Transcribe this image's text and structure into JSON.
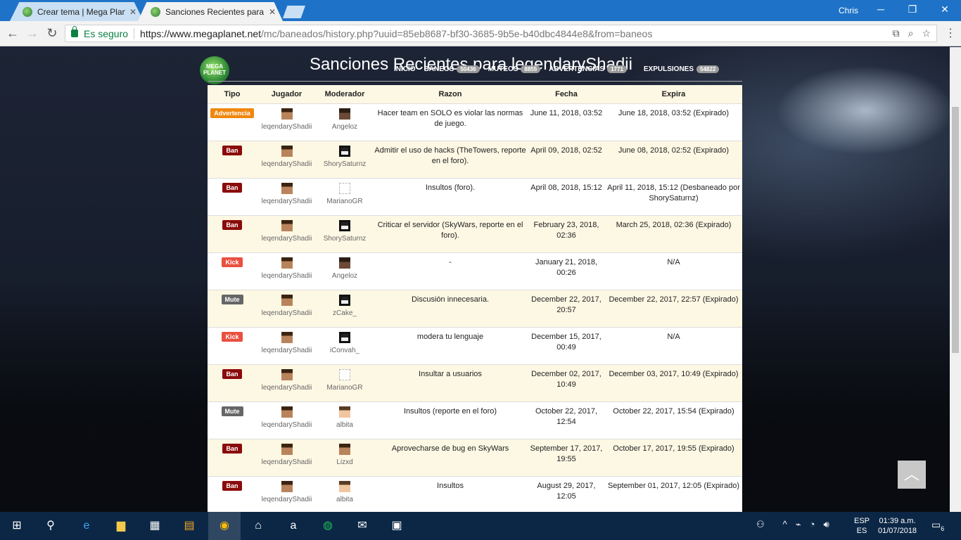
{
  "browser": {
    "tabs": [
      {
        "title": "Crear tema | Mega Planet",
        "close": "✕"
      },
      {
        "title": "Sanciones Recientes para",
        "close": "✕"
      }
    ],
    "user": "Chris",
    "secure_label": "Es seguro",
    "url_host": "https://www.megaplanet.net",
    "url_path": "/mc/baneados/history.php?uuid=85eb8687-bf30-3685-9b5e-b40dbc4844e8&from=baneos"
  },
  "site": {
    "logo_text": "MEGA PLANET",
    "title": "Sanciones Recientes para legendaryShadii",
    "nav": [
      {
        "label": "INICIO",
        "count": ""
      },
      {
        "label": "BANEOS",
        "count": "50436"
      },
      {
        "label": "MUTEOS",
        "count": "8855"
      },
      {
        "label": "ADVERTENCIAS",
        "count": "1771"
      },
      {
        "label": "EXPULSIONES",
        "count": "54822"
      }
    ]
  },
  "table": {
    "headers": [
      "Tipo",
      "Jugador",
      "Moderador",
      "Razon",
      "Fecha",
      "Expira"
    ],
    "rows": [
      {
        "type": "Advertencia",
        "player": "leqendaryShadii",
        "moderator": "Angeloz",
        "reason": "Hacer team en SOLO es violar las normas de juego.",
        "date": "June 11, 2018, 03:52",
        "expires": "June 18, 2018, 03:52 (Expirado)"
      },
      {
        "type": "Ban",
        "player": "leqendaryShadii",
        "moderator": "ShorySaturnz",
        "reason": "Admitir el uso de hacks (TheTowers, reporte en el foro).",
        "date": "April 09, 2018, 02:52",
        "expires": "June 08, 2018, 02:52 (Expirado)"
      },
      {
        "type": "Ban",
        "player": "leqendaryShadii",
        "moderator": "MarianoGR",
        "reason": "Insultos (foro).",
        "date": "April 08, 2018, 15:12",
        "expires": "April 11, 2018, 15:12 (Desbaneado por ShorySaturnz)"
      },
      {
        "type": "Ban",
        "player": "leqendaryShadii",
        "moderator": "ShorySaturnz",
        "reason": "Criticar el servidor (SkyWars, reporte en el foro).",
        "date": "February 23, 2018, 02:36",
        "expires": "March 25, 2018, 02:36 (Expirado)"
      },
      {
        "type": "Kick",
        "player": "leqendaryShadii",
        "moderator": "Angeloz",
        "reason": "-",
        "date": "January 21, 2018, 00:26",
        "expires": "N/A"
      },
      {
        "type": "Mute",
        "player": "leqendaryShadii",
        "moderator": "zCake_",
        "reason": "Discusión innecesaria.",
        "date": "December 22, 2017, 20:57",
        "expires": "December 22, 2017, 22:57 (Expirado)"
      },
      {
        "type": "Kick",
        "player": "leqendaryShadii",
        "moderator": "iConvah_",
        "reason": "modera tu lenguaje",
        "date": "December 15, 2017, 00:49",
        "expires": "N/A"
      },
      {
        "type": "Ban",
        "player": "leqendaryShadii",
        "moderator": "MarianoGR",
        "reason": "Insultar a usuarios",
        "date": "December 02, 2017, 10:49",
        "expires": "December 03, 2017, 10:49 (Expirado)"
      },
      {
        "type": "Mute",
        "player": "leqendaryShadii",
        "moderator": "albita",
        "reason": "Insultos (reporte en el foro)",
        "date": "October 22, 2017, 12:54",
        "expires": "October 22, 2017, 15:54 (Expirado)"
      },
      {
        "type": "Ban",
        "player": "leqendaryShadii",
        "moderator": "Lizxd",
        "reason": "Aprovecharse de bug en SkyWars",
        "date": "September 17, 2017, 19:55",
        "expires": "October 17, 2017, 19:55 (Expirado)"
      },
      {
        "type": "Ban",
        "player": "leqendaryShadii",
        "moderator": "albita",
        "reason": "Insultos",
        "date": "August 29, 2017, 12:05",
        "expires": "September 01, 2017, 12:05 (Expirado)"
      }
    ]
  },
  "taskbar": {
    "lang_top": "ESP",
    "lang_bottom": "ES",
    "time": "01:39 a.m.",
    "date": "01/07/2018",
    "notif_count": "6"
  }
}
